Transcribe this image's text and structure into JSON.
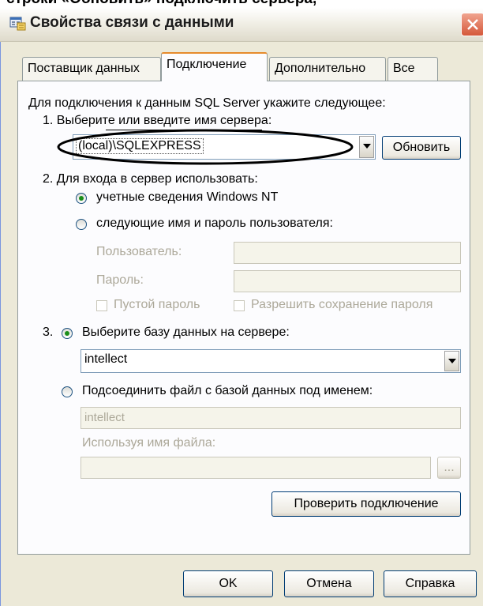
{
  "top_caption": "строки «Обновить» подключить сервера,",
  "window": {
    "title": "Свойства связи с данными",
    "close_label": "×"
  },
  "tabs": [
    {
      "label": "Поставщик данных"
    },
    {
      "label": "Подключение"
    },
    {
      "label": "Дополнительно"
    },
    {
      "label": "Все"
    }
  ],
  "connection": {
    "intro": "Для подключения к данным SQL Server укажите следующее:",
    "step1_label": "1. Выберите или введите имя сервера:",
    "server_value": "(local)\\SQLEXPRESS",
    "refresh_button": "Обновить",
    "step2_label": "2. Для входа в сервер использовать:",
    "radio_windows": "учетные сведения Windows NT",
    "radio_user": "следующие имя и пароль пользователя:",
    "user_label": "Пользователь:",
    "password_label": "Пароль:",
    "blank_password": "Пустой пароль",
    "allow_save_password": "Разрешить сохранение пароля",
    "step3_prefix": "3.",
    "radio_select_db": "Выберите базу данных на сервере:",
    "database_value": "intellect",
    "radio_attach_file": "Подсоединить файл с базой данных под именем:",
    "attach_name_value": "intellect",
    "filename_label": "Используя имя файла:",
    "browse_button": "...",
    "test_button": "Проверить подключение"
  },
  "footer": {
    "ok_button": "OK",
    "cancel_button": "Отмена",
    "help_button": "Справка"
  }
}
